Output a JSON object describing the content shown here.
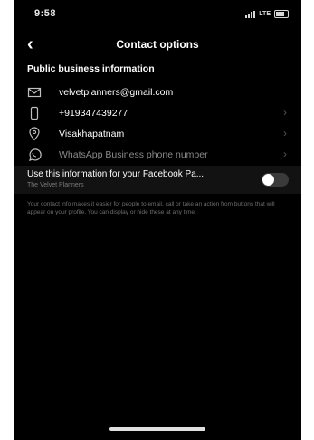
{
  "status_bar": {
    "time": "9:58",
    "network": "LTE"
  },
  "header": {
    "back_icon": "chevron-left-icon",
    "title": "Contact options"
  },
  "section": {
    "title": "Public business information"
  },
  "contacts": [
    {
      "icon": "mail-icon",
      "value": "velvetplanners@gmail.com",
      "chevron": false,
      "muted": false
    },
    {
      "icon": "phone-icon",
      "value": "+919347439277",
      "chevron": true,
      "muted": false
    },
    {
      "icon": "location-pin-icon",
      "value": "Visakhapatnam",
      "chevron": true,
      "muted": false
    },
    {
      "icon": "whatsapp-icon",
      "value": "WhatsApp Business phone number",
      "chevron": true,
      "muted": true
    }
  ],
  "facebook_toggle": {
    "title": "Use this information for your Facebook Pa...",
    "subtitle": "The Velvet Planners",
    "enabled": false
  },
  "helper_text": "Your contact info makes it easier for people to email, call or take an action from buttons that will appear on your profile. You can display or hide these at any time.",
  "colors": {
    "background": "#000000",
    "text": "#ffffff",
    "muted": "#8a8a8a"
  }
}
